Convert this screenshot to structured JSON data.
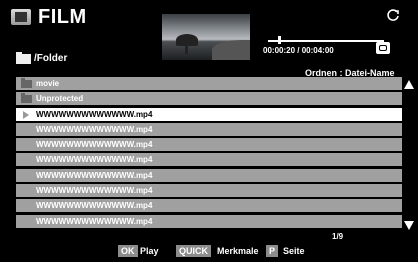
{
  "header": {
    "title": "FILM",
    "folder_path": "/Folder"
  },
  "playback": {
    "time": "00:00:20 / 00:04:00",
    "progress_fraction": 0.083
  },
  "sort": {
    "label": "Ordnen : Datei-Name"
  },
  "list": {
    "items": [
      {
        "type": "folder",
        "label": "movie"
      },
      {
        "type": "folder",
        "label": "Unprotected"
      },
      {
        "type": "file",
        "label": "WWWWWWWWWWWWW.mp4",
        "selected": true
      },
      {
        "type": "file",
        "label": "WWWWWWWWWWWWW.mp4"
      },
      {
        "type": "file",
        "label": "WWWWWWWWWWWWW.mp4"
      },
      {
        "type": "file",
        "label": "WWWWWWWWWWWWW.mp4"
      },
      {
        "type": "file",
        "label": "WWWWWWWWWWWWW.mp4"
      },
      {
        "type": "file",
        "label": "WWWWWWWWWWWWW.mp4"
      },
      {
        "type": "file",
        "label": "WWWWWWWWWWWWW.mp4"
      },
      {
        "type": "file",
        "label": "WWWWWWWWWWWWW.mp4"
      }
    ],
    "page": "1/9"
  },
  "helpbar": {
    "ok_key": "OK",
    "ok_label": "Play",
    "quick_key": "QUICK",
    "quick_label": "Merkmale",
    "p_key": "P",
    "p_label": "Seite"
  },
  "colors": {
    "background": "#000000",
    "row_bg": "#a0a0a0",
    "row_selected_bg": "#ffffff",
    "key_bg": "#8c8c8c"
  },
  "icons": {
    "app": "film-icon",
    "refresh": "refresh-icon",
    "repeat": "repeat-icon",
    "folder": "folder-icon",
    "play": "play-icon",
    "scroll_up": "arrow-up-icon",
    "scroll_down": "arrow-down-icon"
  }
}
